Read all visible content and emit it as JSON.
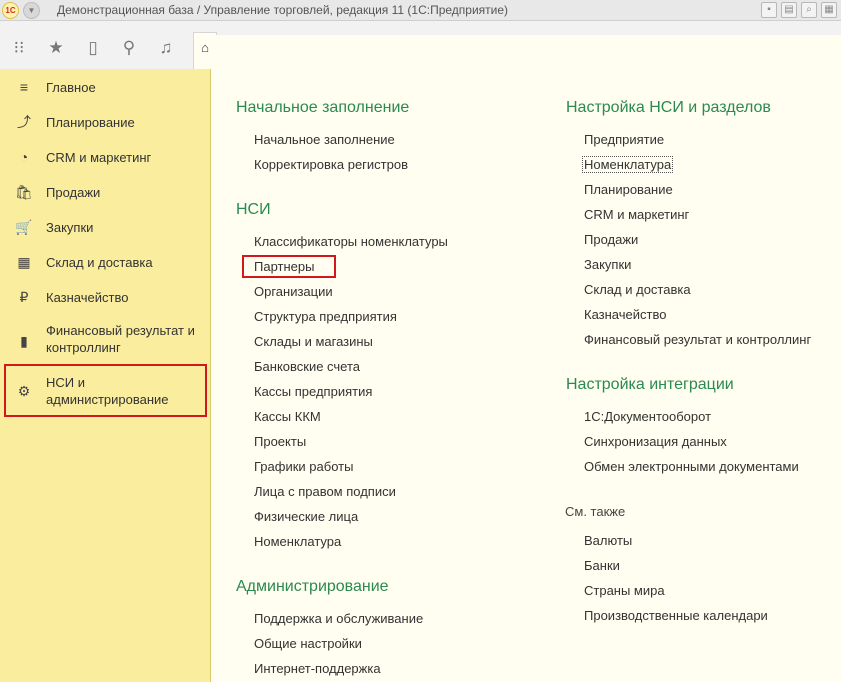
{
  "titlebar": {
    "logo": "1С",
    "title": "Демонстрационная база / Управление торговлей, редакция 11  (1С:Предприятие)"
  },
  "toolbar": {
    "icons": [
      "apps-grid-icon",
      "star-icon",
      "history-icon",
      "search-icon",
      "bell-icon",
      "home-icon"
    ]
  },
  "sidebar": {
    "items": [
      {
        "label": "Главное",
        "icon": "≡"
      },
      {
        "label": "Планирование",
        "icon": "⤴"
      },
      {
        "label": "CRM и маркетинг",
        "icon": "◔"
      },
      {
        "label": "Продажи",
        "icon": "🛍"
      },
      {
        "label": "Закупки",
        "icon": "🛒"
      },
      {
        "label": "Склад и доставка",
        "icon": "▦"
      },
      {
        "label": "Казначейство",
        "icon": "₽"
      },
      {
        "label": "Финансовый результат и",
        "label2": "контроллинг",
        "icon": "▮"
      },
      {
        "label": "НСИ и",
        "label2": "администрирование",
        "icon": "⚙"
      }
    ]
  },
  "left_column": {
    "initial_fill": {
      "title": "Начальное заполнение",
      "links": [
        "Начальное заполнение",
        "Корректировка регистров"
      ]
    },
    "nsi": {
      "title": "НСИ",
      "links": [
        "Классификаторы номенклатуры",
        "Партнеры",
        "Организации",
        "Структура предприятия",
        "Склады и магазины",
        "Банковские счета",
        "Кассы предприятия",
        "Кассы ККМ",
        "Проекты",
        "Графики работы",
        "Лица с правом подписи",
        "Физические лица",
        "Номенклатура"
      ]
    },
    "admin": {
      "title": "Администрирование",
      "links": [
        "Поддержка и обслуживание",
        "Общие настройки",
        "Интернет-поддержка"
      ]
    }
  },
  "right_column": {
    "nsi_settings": {
      "title": "Настройка НСИ и разделов",
      "links": [
        "Предприятие",
        "Номенклатура",
        "Планирование",
        "CRM и маркетинг",
        "Продажи",
        "Закупки",
        "Склад и доставка",
        "Казначейство",
        "Финансовый результат и контроллинг"
      ]
    },
    "integration": {
      "title": "Настройка интеграции",
      "links": [
        "1С:Документооборот",
        "Синхронизация данных",
        "Обмен электронными документами"
      ]
    },
    "see_also": {
      "title": "См. также",
      "links": [
        "Валюты",
        "Банки",
        "Страны мира",
        "Производственные календари"
      ]
    }
  },
  "colors": {
    "sidebar_bg": "#fbed9e",
    "section_green": "#2a8a4f",
    "highlight_red": "#d2171d",
    "content_bg": "#fffef0"
  }
}
